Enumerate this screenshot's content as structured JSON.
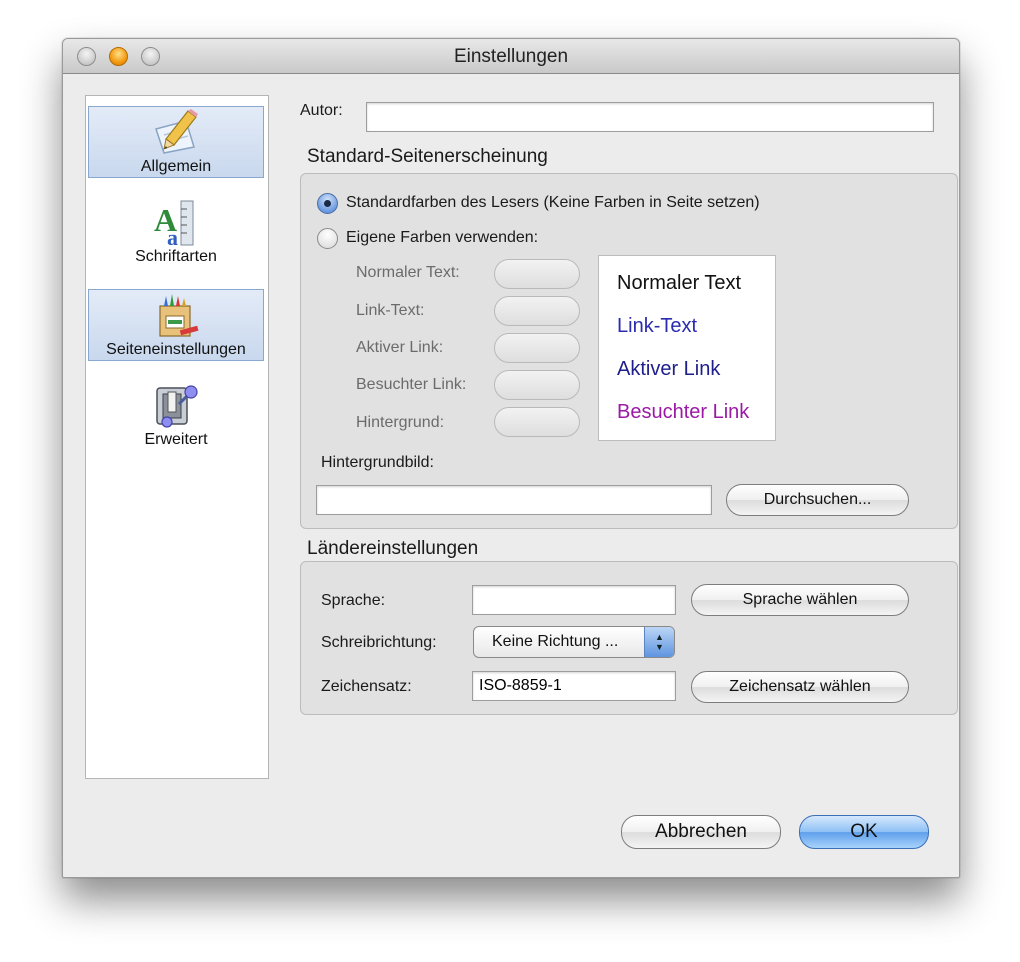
{
  "window": {
    "title": "Einstellungen"
  },
  "sidebar": {
    "items": [
      {
        "label": "Allgemein",
        "icon": "pencil-paper-icon",
        "selected": true
      },
      {
        "label": "Schriftarten",
        "icon": "font-icon",
        "selected": false
      },
      {
        "label": "Seiteneinstellungen",
        "icon": "page-settings-icon",
        "selected": true
      },
      {
        "label": "Erweitert",
        "icon": "switch-icon",
        "selected": false
      }
    ]
  },
  "author": {
    "label": "Autor:",
    "value": ""
  },
  "appearance": {
    "title": "Standard-Seitenerscheinung",
    "option_default": "Standardfarben des Lesers (Keine Farben in Seite setzen)",
    "option_custom": "Eigene Farben verwenden:",
    "selected_option": "default",
    "color_labels": {
      "normal": "Normaler Text:",
      "link": "Link-Text:",
      "active": "Aktiver Link:",
      "visited": "Besuchter Link:",
      "background": "Hintergrund:"
    },
    "preview": {
      "normal": "Normaler Text",
      "link": "Link-Text",
      "active": "Aktiver Link",
      "visited": "Besuchter Link"
    },
    "preview_colors": {
      "normal": "#111111",
      "link": "#2b2bb0",
      "active": "#1e1e8c",
      "visited": "#9a1aa6"
    },
    "bg_image_label": "Hintergrundbild:",
    "bg_image_value": "",
    "browse_button": "Durchsuchen..."
  },
  "locale": {
    "title": "Ländereinstellungen",
    "language_label": "Sprache:",
    "language_value": "",
    "language_button": "Sprache wählen",
    "direction_label": "Schreibrichtung:",
    "direction_value": "Keine Richtung ...",
    "charset_label": "Zeichensatz:",
    "charset_value": "ISO-8859-1",
    "charset_button": "Zeichensatz wählen"
  },
  "footer": {
    "cancel": "Abbrechen",
    "ok": "OK"
  }
}
